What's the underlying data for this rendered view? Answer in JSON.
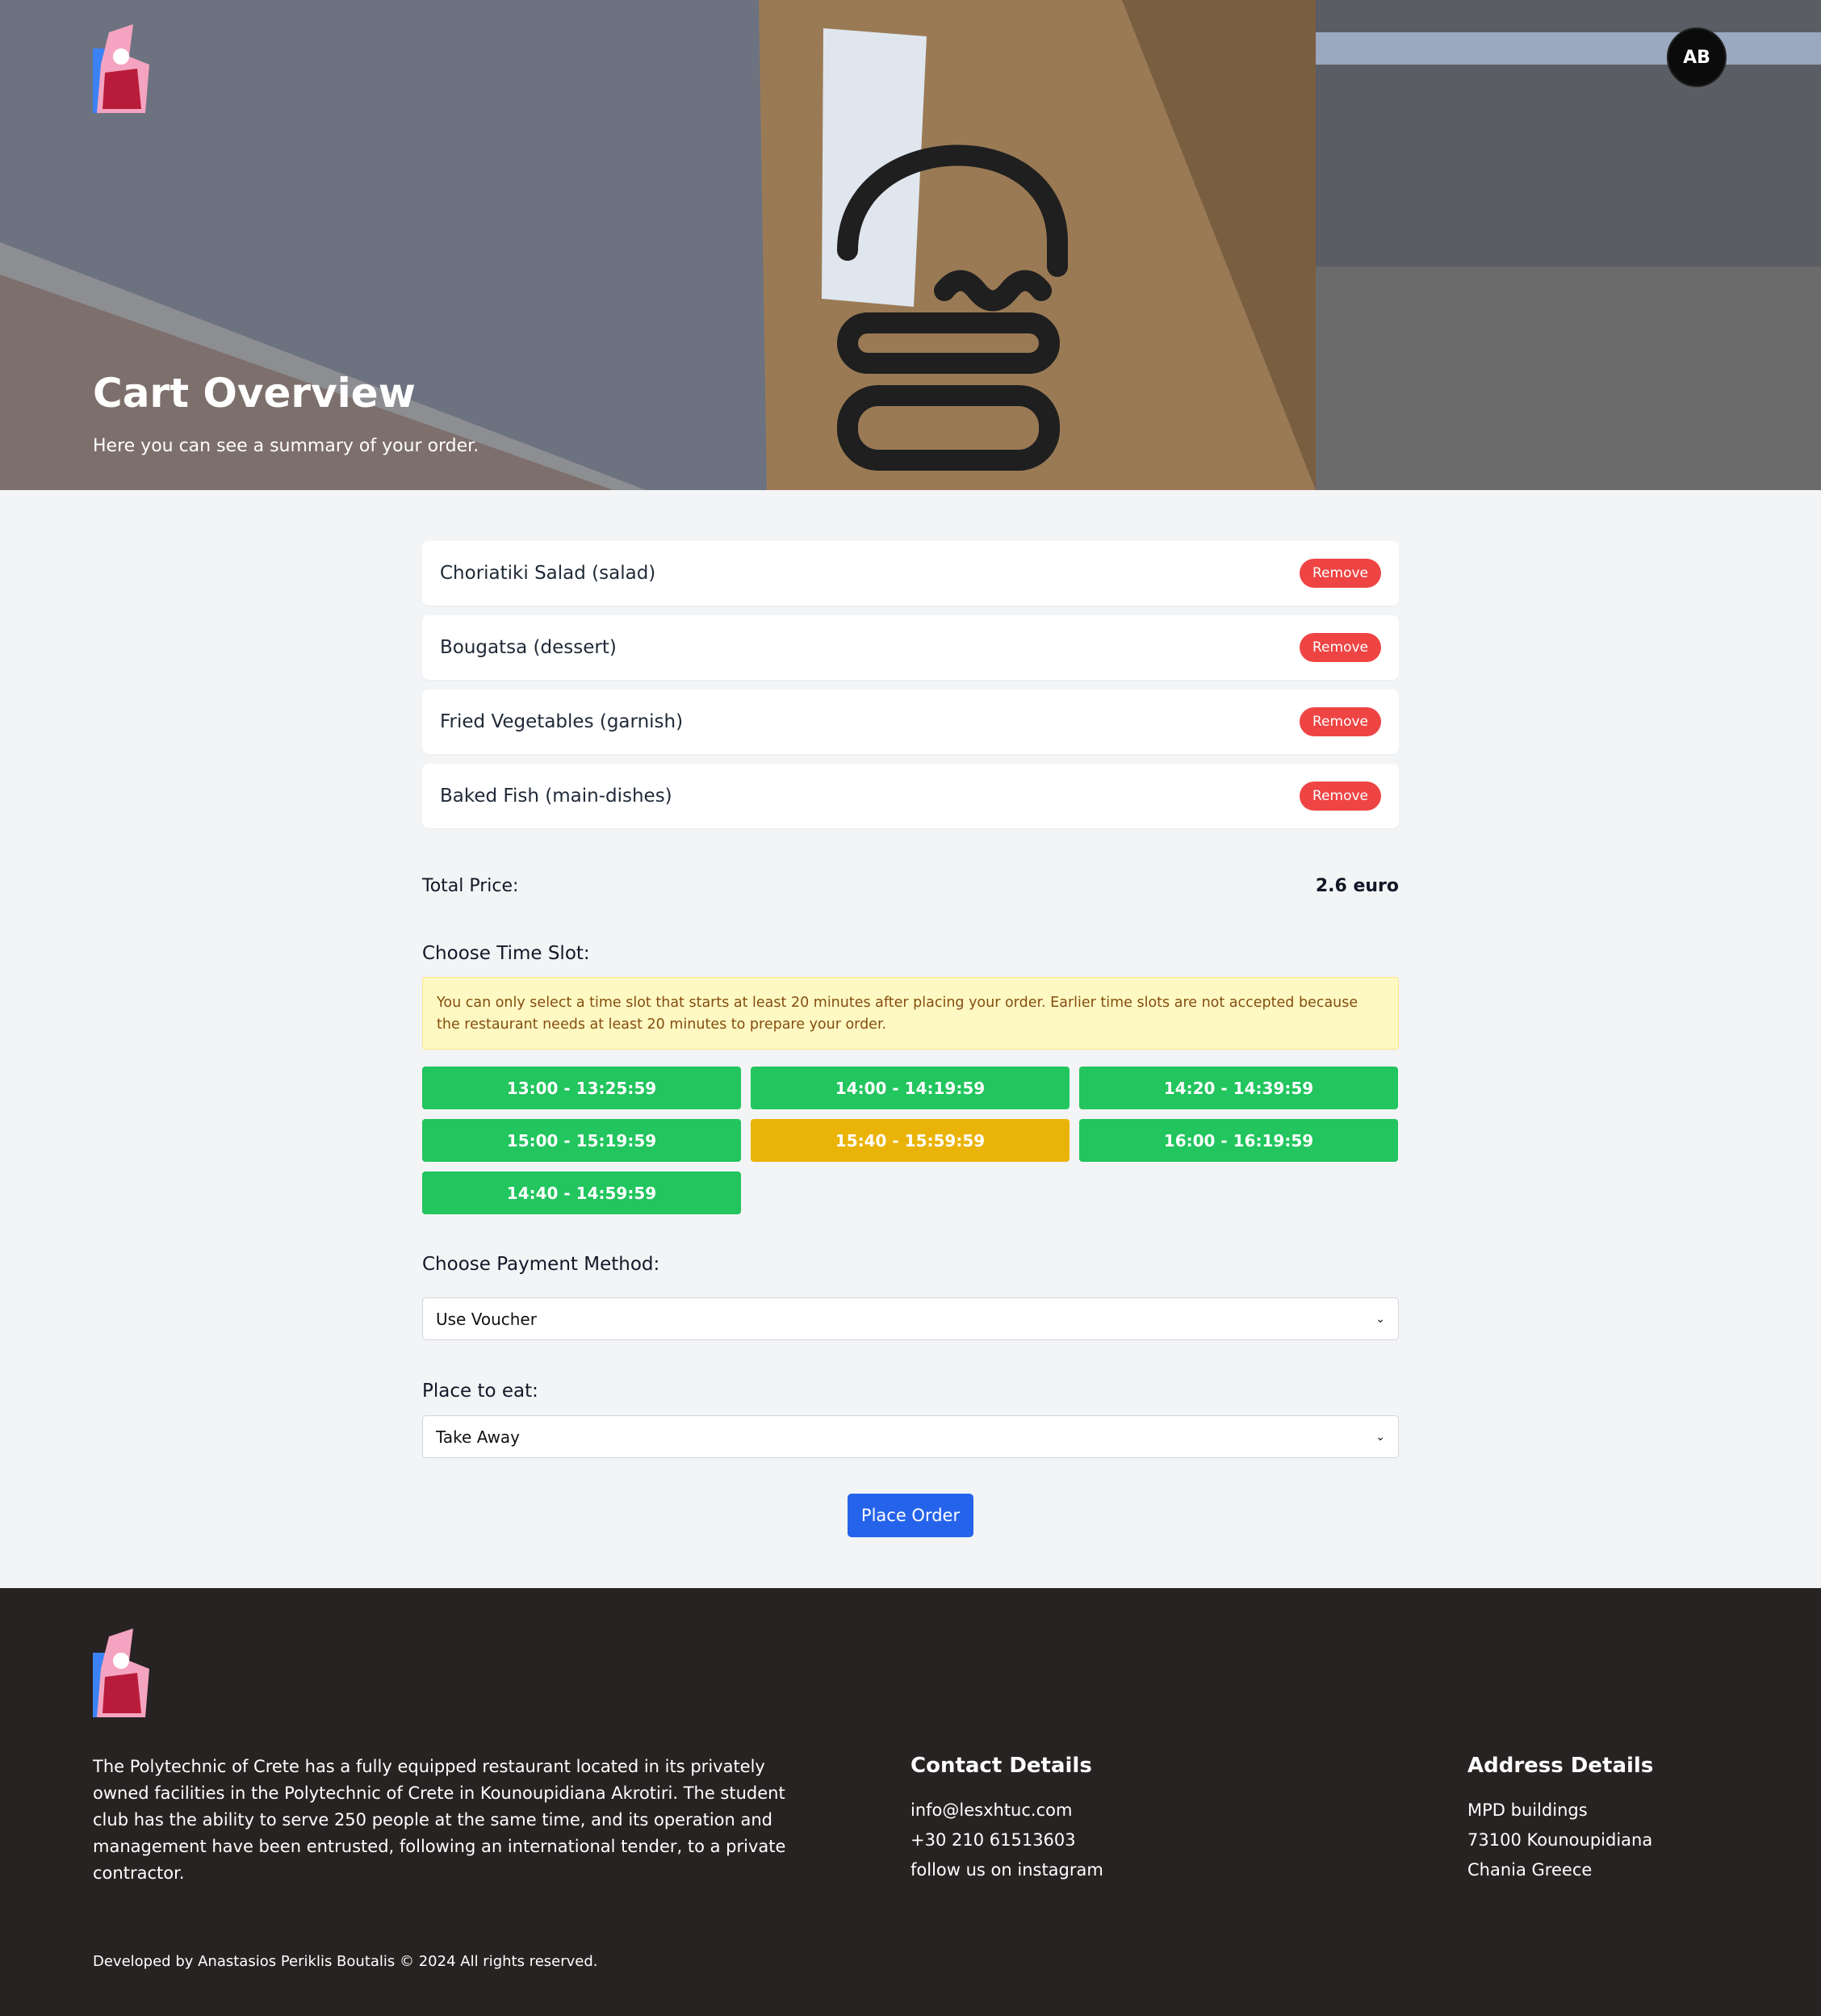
{
  "header": {
    "title": "Cart Overview",
    "subtitle": "Here you can see a summary of your order.",
    "avatar_initials": "AB"
  },
  "cart": {
    "items": [
      {
        "name": "Choriatiki Salad (salad)",
        "remove_label": "Remove"
      },
      {
        "name": "Bougatsa (dessert)",
        "remove_label": "Remove"
      },
      {
        "name": "Fried Vegetables (garnish)",
        "remove_label": "Remove"
      },
      {
        "name": "Baked Fish (main-dishes)",
        "remove_label": "Remove"
      }
    ],
    "total_label": "Total Price:",
    "total_value": "2.6 euro"
  },
  "timeslots": {
    "label": "Choose Time Slot:",
    "notice": "You can only select a time slot that starts at least 20 minutes after placing your order. Earlier time slots are not accepted because the restaurant needs at least 20 minutes to prepare your order.",
    "slots": [
      {
        "label": "13:00 - 13:25:59",
        "selected": false
      },
      {
        "label": "14:00 - 14:19:59",
        "selected": false
      },
      {
        "label": "14:20 - 14:39:59",
        "selected": false
      },
      {
        "label": "15:00 - 15:19:59",
        "selected": false
      },
      {
        "label": "15:40 - 15:59:59",
        "selected": true
      },
      {
        "label": "16:00 - 16:19:59",
        "selected": false
      },
      {
        "label": "14:40 - 14:59:59",
        "selected": false
      }
    ],
    "colors": {
      "available": "#22c55e",
      "selected": "#eab308"
    }
  },
  "payment": {
    "label": "Choose Payment Method:",
    "selected": "Use Voucher"
  },
  "place": {
    "label": "Place to eat:",
    "selected": "Take Away"
  },
  "actions": {
    "place_order": "Place Order"
  },
  "footer": {
    "about": "The Polytechnic of Crete has a fully equipped restaurant located in its privately owned facilities in the Polytechnic of Crete in Kounoupidiana Akrotiri. The student club has the ability to serve 250 people at the same time, and its operation and management have been entrusted, following an international tender, to a private contractor.",
    "contact": {
      "title": "Contact Details",
      "email": "info@lesxhtuc.com",
      "phone": "+30 210 61513603",
      "social": "follow us on instagram"
    },
    "address": {
      "title": "Address Details",
      "line1": "MPD buildings",
      "line2": "73100 Kounoupidiana",
      "line3": "Chania Greece"
    },
    "copyright": "Developed by Anastasios Periklis Boutalis © 2024 All rights reserved."
  }
}
